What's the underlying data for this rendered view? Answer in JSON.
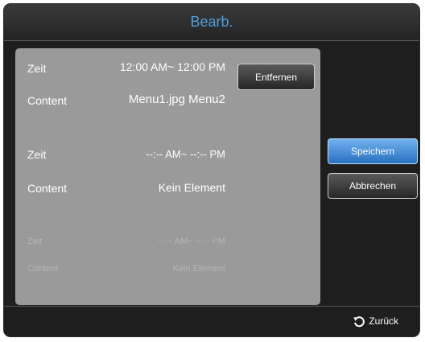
{
  "dialog": {
    "title": "Bearb."
  },
  "entries": [
    {
      "time_label": "Zeit",
      "time_value": "12:00 AM~ 12:00 PM",
      "content_label": "Content",
      "content_value": "Menu1.jpg Menu2"
    },
    {
      "time_label": "Zeit",
      "time_value": "--:-- AM~ --:-- PM",
      "content_label": "Content",
      "content_value": "Kein Element"
    },
    {
      "time_label": "Zeit",
      "time_value": "--:-- AM~ --:-- PM",
      "content_label": "Content",
      "content_value": "Kein Element"
    }
  ],
  "buttons": {
    "remove": "Entfernen",
    "save": "Speichern",
    "cancel": "Abbrechen"
  },
  "footer": {
    "back_label": "Zurück",
    "back_icon": "return-arrow-icon"
  },
  "colors": {
    "accent": "#4f9fe0",
    "panel": "#9a9a9a",
    "primary_button": "#3f8ad6"
  }
}
